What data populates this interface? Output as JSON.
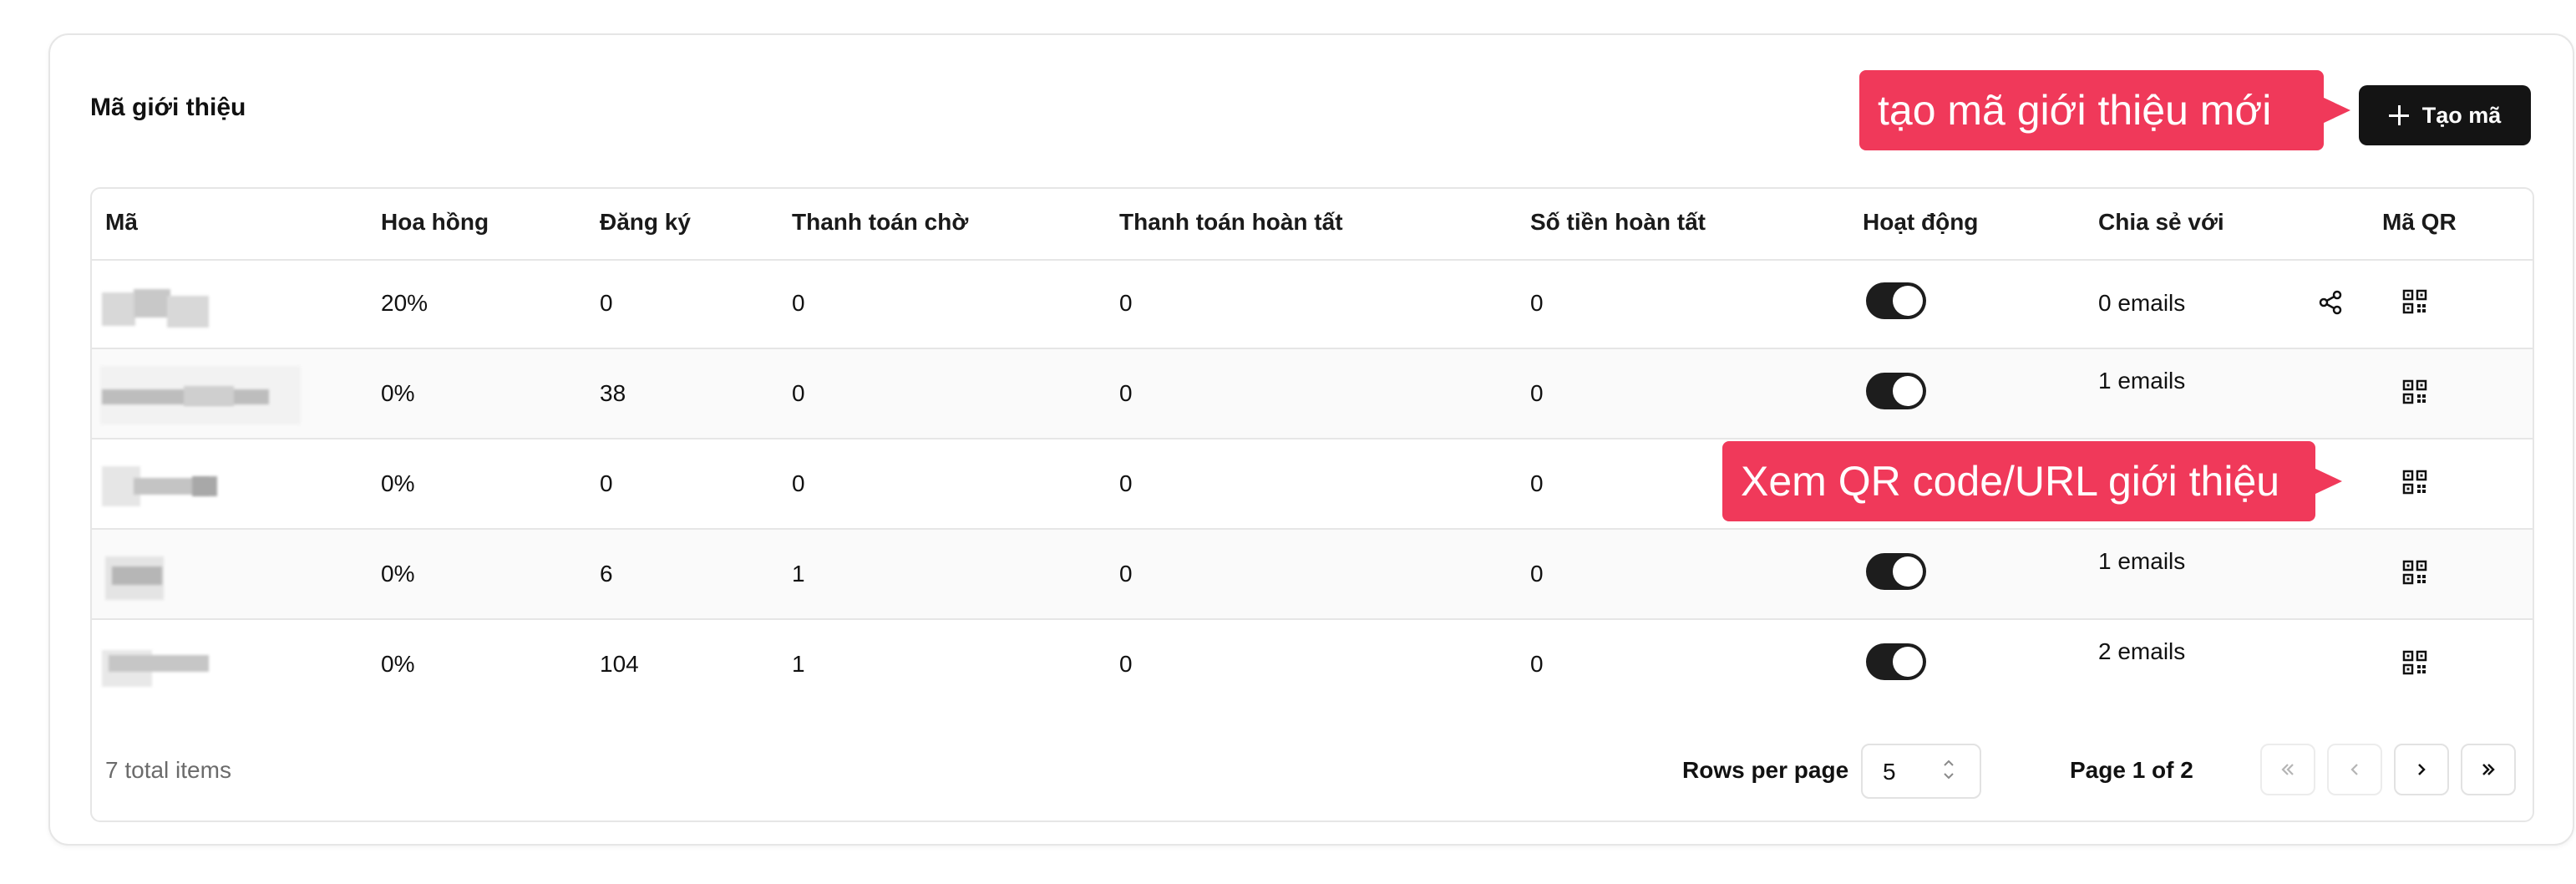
{
  "card": {
    "title": "Mã giới thiệu"
  },
  "create_button": {
    "label": "Tạo mã"
  },
  "table": {
    "columns": [
      "Mã",
      "Hoa hồng",
      "Đăng ký",
      "Thanh toán chờ",
      "Thanh toán hoàn tất",
      "Số tiền hoàn tất",
      "Hoạt động",
      "Chia sẻ với",
      "Mã QR"
    ],
    "rows": [
      {
        "commission": "20%",
        "signups": "0",
        "pending": "0",
        "completed": "0",
        "amount": "0",
        "shared": "0 emails",
        "active": true
      },
      {
        "commission": "0%",
        "signups": "38",
        "pending": "0",
        "completed": "0",
        "amount": "0",
        "shared": "1 emails",
        "active": true
      },
      {
        "commission": "0%",
        "signups": "0",
        "pending": "0",
        "completed": "0",
        "amount": "0",
        "shared": "",
        "active": true
      },
      {
        "commission": "0%",
        "signups": "6",
        "pending": "1",
        "completed": "0",
        "amount": "0",
        "shared": "1 emails",
        "active": true
      },
      {
        "commission": "0%",
        "signups": "104",
        "pending": "1",
        "completed": "0",
        "amount": "0",
        "shared": "2 emails",
        "active": true
      }
    ]
  },
  "footer": {
    "total": "7 total items",
    "rows_per_page_label": "Rows per page",
    "rows_per_page_value": "5",
    "page_info": "Page 1 of 2"
  },
  "annotations": {
    "create": "tạo mã giới thiệu mới",
    "qr": "Xem QR code/URL giới thiệu"
  },
  "colors": {
    "accent": "#f0395a",
    "button": "#141414",
    "toggle_on": "#1d1d1d"
  }
}
